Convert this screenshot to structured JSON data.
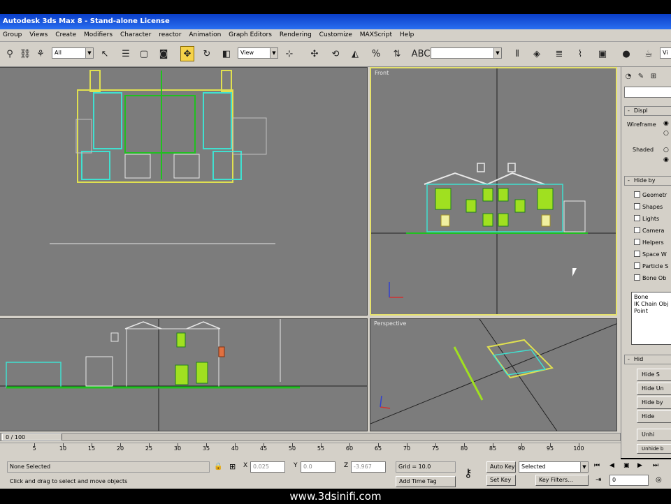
{
  "title": "Autodesk 3ds Max 8  - Stand-alone License",
  "menu": [
    "Group",
    "Views",
    "Create",
    "Modifiers",
    "Character",
    "reactor",
    "Animation",
    "Graph Editors",
    "Rendering",
    "Customize",
    "MAXScript",
    "Help"
  ],
  "toolbar": {
    "selection_filter": "All",
    "ref_coord": "View",
    "named_sets": ""
  },
  "viewports": {
    "top_right": "Front",
    "bottom_right": "Perspective"
  },
  "command_panel": {
    "display_rollout": "Displ",
    "wireframe_label": "Wireframe",
    "shaded_label": "Shaded",
    "hide_by_rollout": "Hide by",
    "categories": [
      "Geometr",
      "Shapes",
      "Lights",
      "Camera",
      "Helpers",
      "Space W",
      "Particle S",
      "Bone Ob"
    ],
    "list_items": [
      "Bone",
      "IK Chain Obj",
      "Point"
    ],
    "hide_rollout": "Hid",
    "buttons": [
      "Hide S",
      "Hide Un",
      "Hide by",
      "Hide",
      "Unhi",
      "Unhide b"
    ]
  },
  "timeline": {
    "position": "0 / 100",
    "ticks": [
      "5",
      "10",
      "15",
      "20",
      "25",
      "30",
      "35",
      "40",
      "45",
      "50",
      "55",
      "60",
      "65",
      "70",
      "75",
      "80",
      "85",
      "90",
      "95",
      "100"
    ]
  },
  "status": {
    "selection": "None Selected",
    "prompt": "Click and drag to select and move objects",
    "x_label": "X",
    "x_value": "0.025",
    "y_label": "Y",
    "y_value": "0.0",
    "z_label": "Z",
    "z_value": "-3.967",
    "grid": "Grid = 10.0",
    "add_time_tag": "Add Time Tag",
    "auto_key": "Auto Key",
    "set_key": "Set Key",
    "key_mode": "Selected",
    "key_filters": "Key Filters...",
    "frame": "0"
  },
  "watermark": "www.3dsinifi.com"
}
